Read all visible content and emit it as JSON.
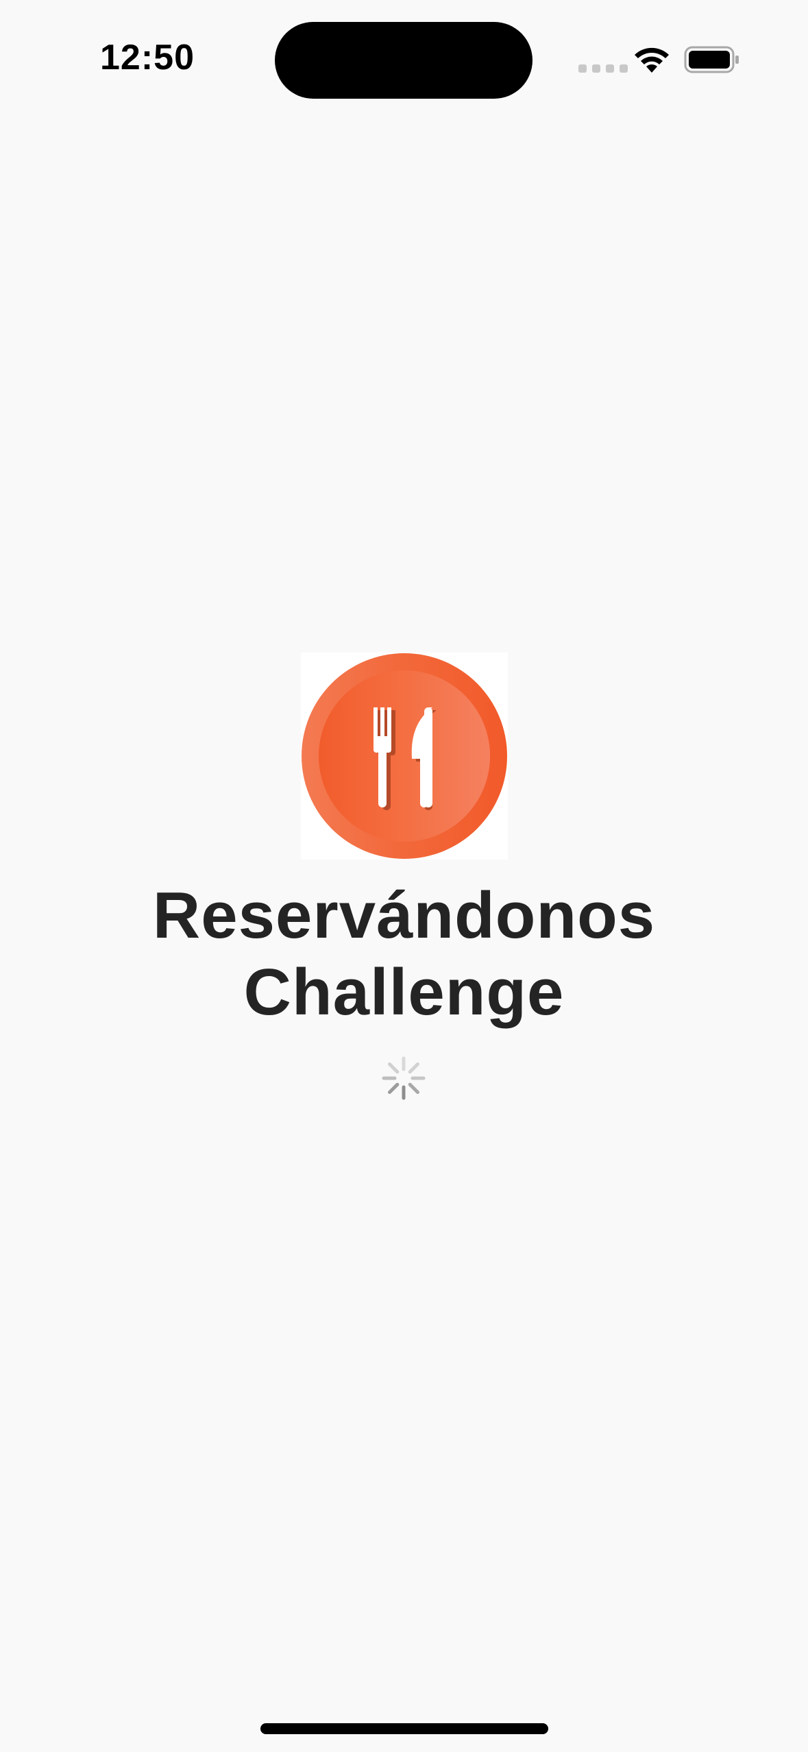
{
  "status_bar": {
    "time": "12:50",
    "signal_icon": "cellular-signal-icon",
    "wifi_icon": "wifi-icon",
    "battery_icon": "battery-icon"
  },
  "splash": {
    "logo_icon": "fork-knife-icon",
    "title_line1": "Reservándonos",
    "title_line2": "Challenge",
    "loading_icon": "activity-spinner-icon"
  },
  "colors": {
    "background": "#f9f9f9",
    "logo_orange": "#f26836",
    "logo_orange_light": "#f47a52",
    "title_text": "#242424"
  }
}
